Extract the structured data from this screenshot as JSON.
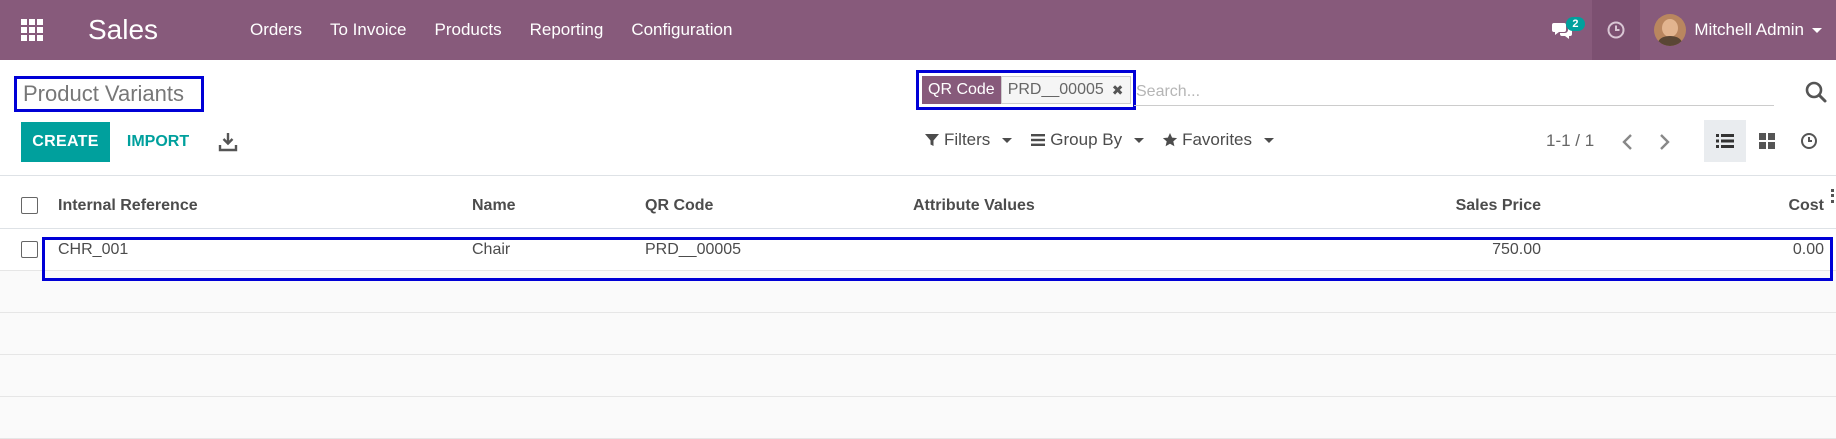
{
  "navbar": {
    "app_title": "Sales",
    "menu": [
      "Orders",
      "To Invoice",
      "Products",
      "Reporting",
      "Configuration"
    ],
    "messages_count": "2",
    "user_name": "Mitchell Admin"
  },
  "control_panel": {
    "title": "Product Variants",
    "search": {
      "facet_label": "QR Code",
      "facet_value": "PRD__00005",
      "placeholder": "Search..."
    },
    "create_label": "CREATE",
    "import_label": "IMPORT",
    "filters_label": "Filters",
    "group_by_label": "Group By",
    "favorites_label": "Favorites",
    "pager": "1-1 / 1"
  },
  "table": {
    "columns": [
      "Internal Reference",
      "Name",
      "QR Code",
      "Attribute Values",
      "Sales Price",
      "Cost"
    ],
    "rows": [
      {
        "ref": "CHR_001",
        "name": "Chair",
        "qr": "PRD__00005",
        "attributes": "",
        "price": "750.00",
        "cost": "0.00"
      }
    ]
  },
  "colors": {
    "brand": "#875a7b",
    "accent": "#00a09d",
    "highlight": "#0000d6"
  }
}
